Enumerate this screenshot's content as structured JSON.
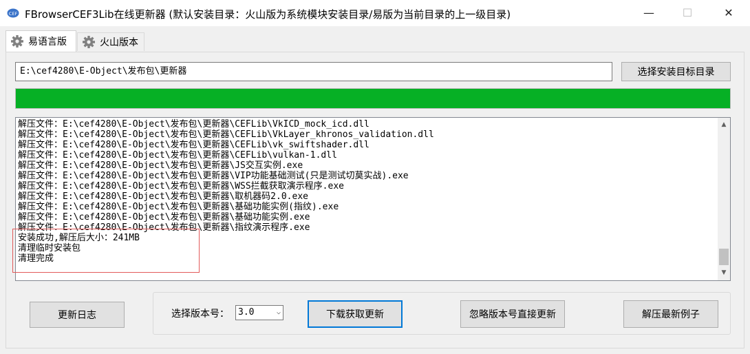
{
  "window": {
    "title": "FBrowserCEF3Lib在线更新器 (默认安装目录：火山版为系统模块安装目录/易版为当前目录的上一级目录)",
    "app_icon_text": "CEF",
    "min_glyph": "—",
    "max_glyph": "☐",
    "close_glyph": "✕"
  },
  "tabs": [
    {
      "label": "易语言版",
      "icon": "gear-icon",
      "active": true
    },
    {
      "label": "火山版本",
      "icon": "gear-icon",
      "active": false
    }
  ],
  "path_input": {
    "value": "E:\\cef4280\\E-Object\\发布包\\更新器"
  },
  "select_dir_button": "选择安装目标目录",
  "progress": {
    "value_percent": 100,
    "color": "#06b025"
  },
  "log": {
    "lines": [
      "解压文件：E:\\cef4280\\E-Object\\发布包\\更新器\\CEFLib\\VkICD_mock_icd.dll",
      "解压文件：E:\\cef4280\\E-Object\\发布包\\更新器\\CEFLib\\VkLayer_khronos_validation.dll",
      "解压文件：E:\\cef4280\\E-Object\\发布包\\更新器\\CEFLib\\vk_swiftshader.dll",
      "解压文件：E:\\cef4280\\E-Object\\发布包\\更新器\\CEFLib\\vulkan-1.dll",
      "解压文件：E:\\cef4280\\E-Object\\发布包\\更新器\\JS交互实例.exe",
      "解压文件：E:\\cef4280\\E-Object\\发布包\\更新器\\VIP功能基础测试(只是测试切莫实战).exe",
      "解压文件：E:\\cef4280\\E-Object\\发布包\\更新器\\WSS拦截获取演示程序.exe",
      "解压文件：E:\\cef4280\\E-Object\\发布包\\更新器\\取机器码2.0.exe",
      "解压文件：E:\\cef4280\\E-Object\\发布包\\更新器\\基础功能实例(指纹).exe",
      "解压文件：E:\\cef4280\\E-Object\\发布包\\更新器\\基础功能实例.exe",
      "解压文件：E:\\cef4280\\E-Object\\发布包\\更新器\\指纹演示程序.exe",
      "安装成功,解压后大小：241MB",
      "清理临时安装包",
      "清理完成"
    ],
    "highlight_color": "#e25a5a"
  },
  "bottom": {
    "changelog_button": "更新日志",
    "version_label": "选择版本号：",
    "version_value": "3.0",
    "download_button": "下载获取更新",
    "ignore_version_button": "忽略版本号直接更新",
    "extract_example_button": "解压最新例子"
  }
}
